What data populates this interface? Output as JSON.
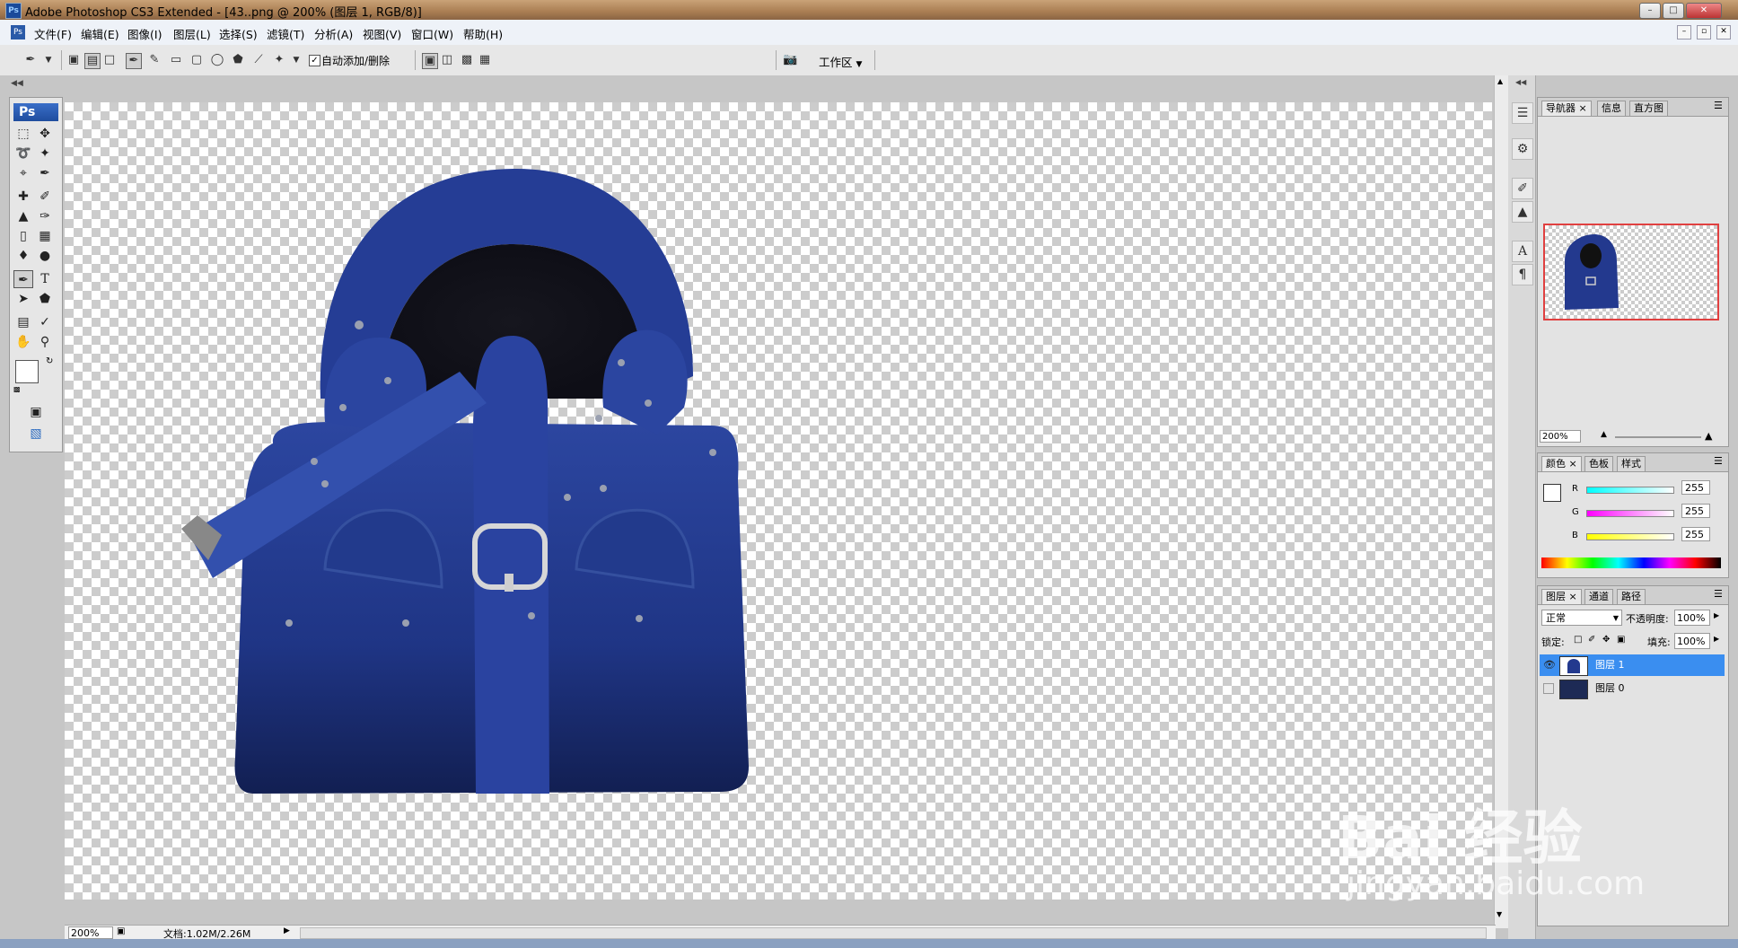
{
  "window": {
    "title": "Adobe Photoshop CS3 Extended - [43..png @ 200% (图层 1, RGB/8)]",
    "app_badge": "Ps"
  },
  "menu": [
    "文件(F)",
    "编辑(E)",
    "图像(I)",
    "图层(L)",
    "选择(S)",
    "滤镜(T)",
    "分析(A)",
    "视图(V)",
    "窗口(W)",
    "帮助(H)"
  ],
  "options": {
    "auto_add_delete": "自动添加/删除",
    "workspace": "工作区"
  },
  "toolbox": {
    "logo": "Ps"
  },
  "navigator": {
    "tabs": [
      "导航器",
      "信息",
      "直方图"
    ],
    "zoom": "200%"
  },
  "color": {
    "tabs": [
      "颜色",
      "色板",
      "样式"
    ],
    "channels": [
      {
        "label": "R",
        "value": "255"
      },
      {
        "label": "G",
        "value": "255"
      },
      {
        "label": "B",
        "value": "255"
      }
    ]
  },
  "layers": {
    "tabs": [
      "图层",
      "通道",
      "路径"
    ],
    "blend_mode": "正常",
    "opacity_label": "不透明度:",
    "opacity": "100%",
    "lock_label": "锁定:",
    "fill_label": "填充:",
    "fill": "100%",
    "items": [
      {
        "name": "图层 1",
        "selected": true,
        "visible": true
      },
      {
        "name": "图层 0",
        "selected": false,
        "visible": false
      }
    ]
  },
  "status": {
    "zoom": "200%",
    "doc": "文档:1.02M/2.26M"
  },
  "watermark": {
    "brand": "Bai 经验",
    "url": "jingyan.baidu.com"
  }
}
